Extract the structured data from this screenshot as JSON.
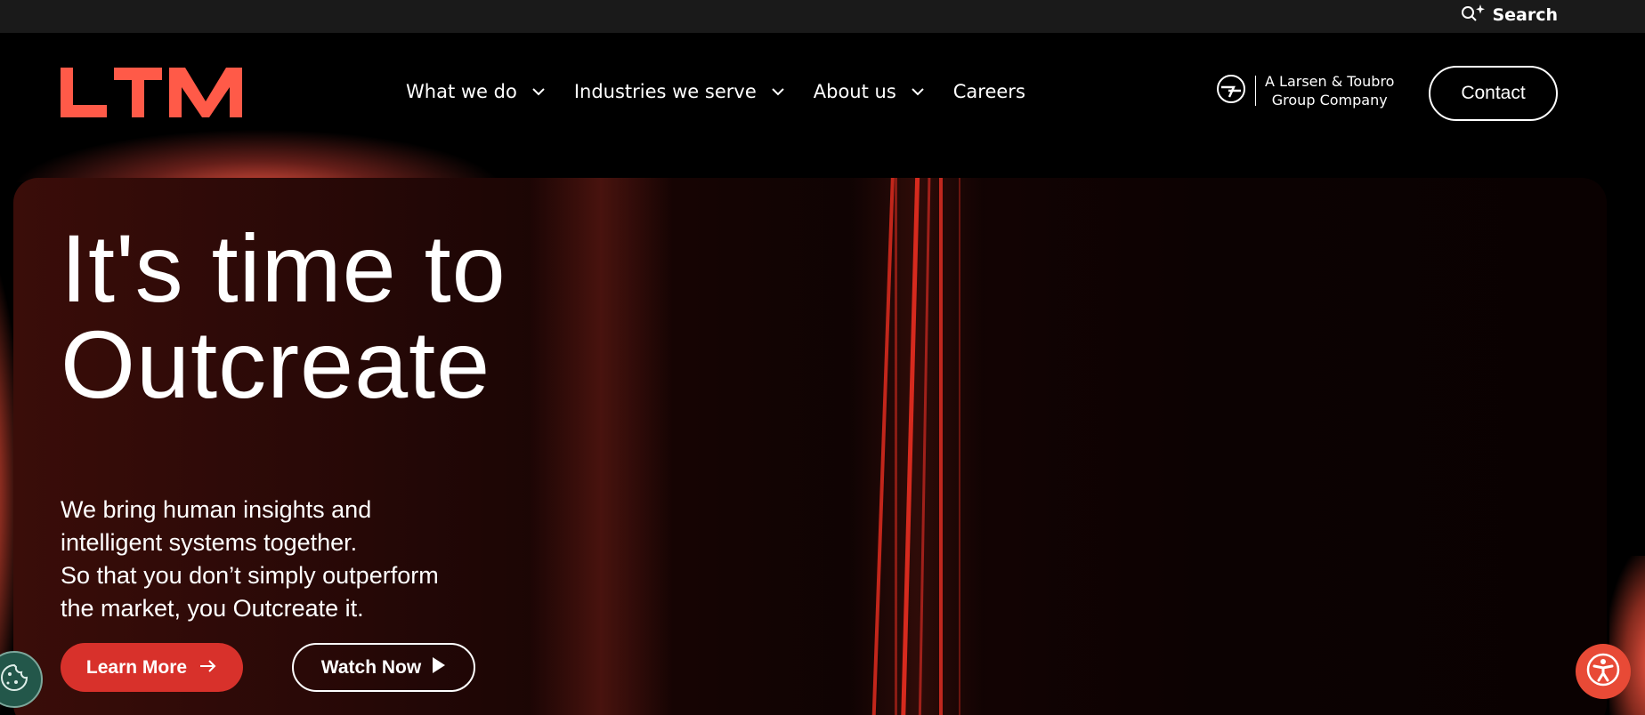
{
  "topbar": {
    "search_label": "Search",
    "search_icon": "sparkle-search-icon"
  },
  "header": {
    "logo_text": "LTM",
    "brand_color": "#ff5a48",
    "nav": [
      {
        "label": "What we do",
        "has_dropdown": true
      },
      {
        "label": "Industries we serve",
        "has_dropdown": true
      },
      {
        "label": "About us",
        "has_dropdown": true
      },
      {
        "label": "Careers",
        "has_dropdown": false
      }
    ],
    "group_badge": {
      "line1": "A Larsen & Toubro",
      "line2": "Group Company"
    },
    "contact_label": "Contact"
  },
  "hero": {
    "title_line1": "It's time to",
    "title_line2": "Outcreate",
    "subtitle_lines": [
      "We bring human insights and",
      "intelligent systems together.",
      "So that you don’t simply outperform",
      "the market, you Outcreate it."
    ],
    "learn_more_label": "Learn More",
    "watch_now_label": "Watch Now",
    "accent_color": "#d8312b"
  },
  "widgets": {
    "cookie_icon": "cookie-icon",
    "accessibility_icon": "accessibility-icon",
    "accessibility_color": "#e84a36"
  }
}
